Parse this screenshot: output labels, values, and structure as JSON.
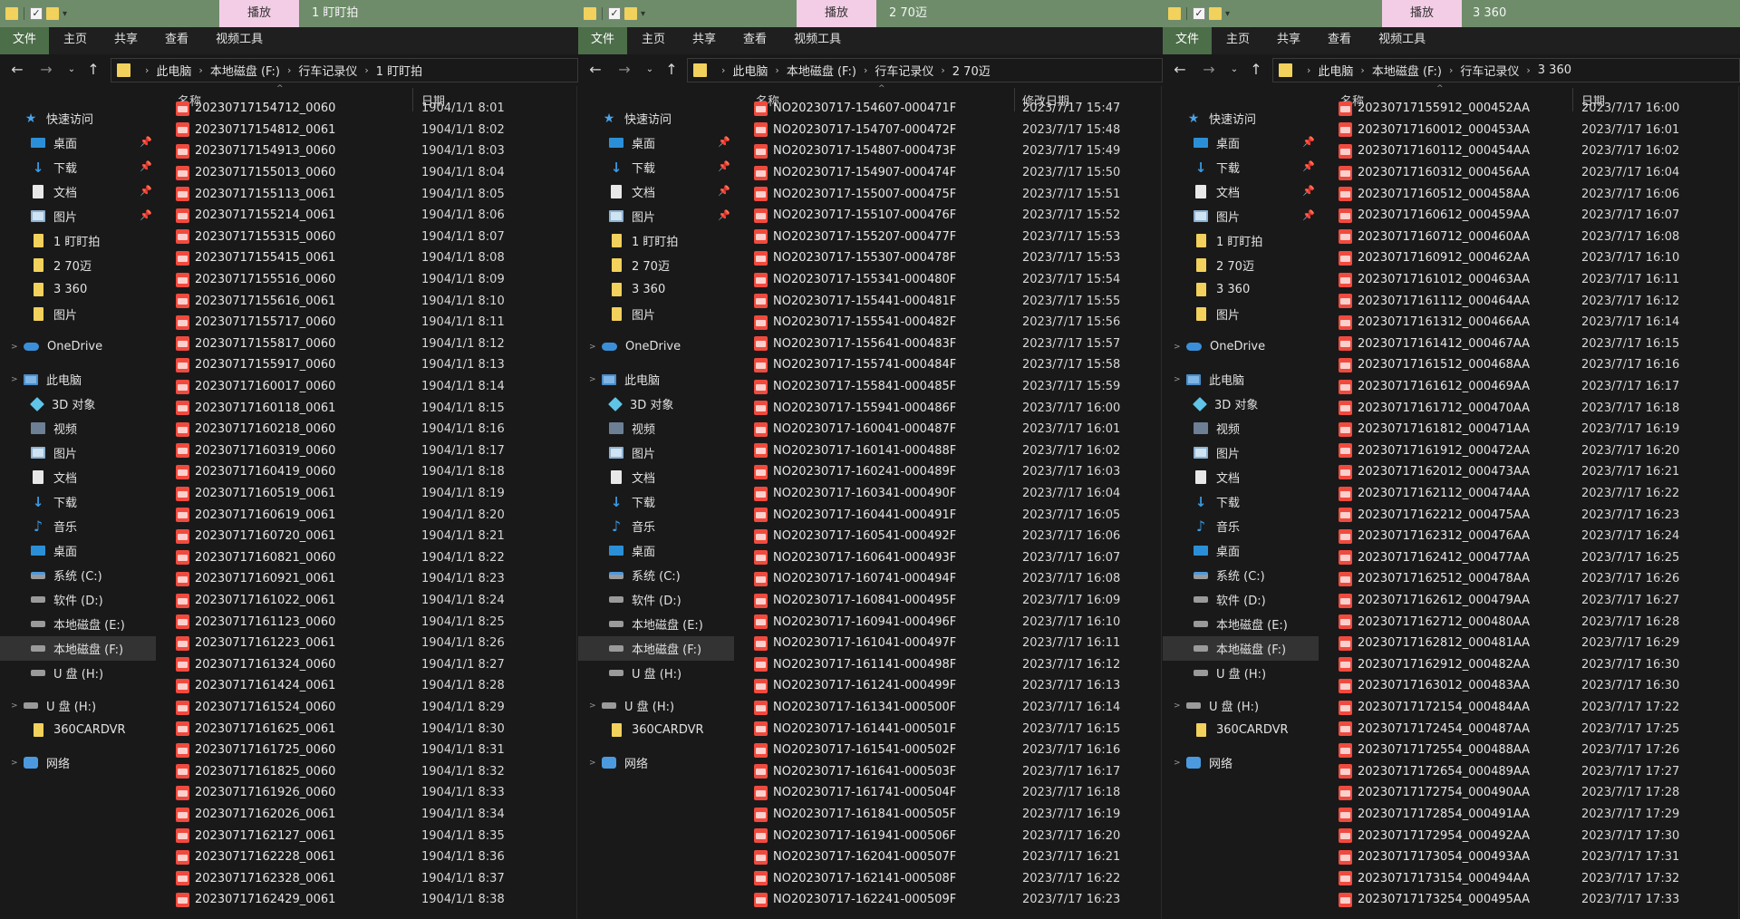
{
  "common": {
    "ribbon_tabs": [
      "文件",
      "主页",
      "共享",
      "查看",
      "视频工具"
    ],
    "context_tab": "播放",
    "column_name": "名称",
    "column_date_short": "日期",
    "column_date_modified": "修改日期",
    "breadcrumb_root": [
      "此电脑",
      "本地磁盘 (F:)",
      "行车记录仪"
    ],
    "quick_access_check": "✓",
    "nav_back_icon": "←",
    "nav_forward_icon": "→",
    "nav_recent_icon": "⌄",
    "nav_up_icon": "↑",
    "chevron": "›",
    "pin_icon": "📌",
    "sort_arrow": "^",
    "expand_icon": ">",
    "sidebar": [
      {
        "label": "快速访问",
        "icon": "star-icon",
        "level": 0,
        "pinned": false
      },
      {
        "label": "桌面",
        "icon": "desktop-icon",
        "level": 1,
        "pinned": true
      },
      {
        "label": "下载",
        "icon": "download-icon",
        "level": 1,
        "pinned": true
      },
      {
        "label": "文档",
        "icon": "document-icon",
        "level": 1,
        "pinned": true
      },
      {
        "label": "图片",
        "icon": "pictures-icon",
        "level": 1,
        "pinned": true
      },
      {
        "label": "1 盯盯拍",
        "icon": "folder-icon",
        "level": 1,
        "pinned": false
      },
      {
        "label": "2 70迈",
        "icon": "folder-icon",
        "level": 1,
        "pinned": false
      },
      {
        "label": "3 360",
        "icon": "folder-icon",
        "level": 1,
        "pinned": false
      },
      {
        "label": "图片",
        "icon": "folder-icon",
        "level": 1,
        "pinned": false
      },
      {
        "label": "OneDrive",
        "icon": "cloud-icon",
        "level": 0,
        "pinned": false,
        "gap": true
      },
      {
        "label": "此电脑",
        "icon": "computer-icon",
        "level": 0,
        "pinned": false,
        "gap": true
      },
      {
        "label": "3D 对象",
        "icon": "3d-objects-icon",
        "level": 1,
        "pinned": false
      },
      {
        "label": "视频",
        "icon": "video-icon",
        "level": 1,
        "pinned": false
      },
      {
        "label": "图片",
        "icon": "pictures-icon",
        "level": 1,
        "pinned": false
      },
      {
        "label": "文档",
        "icon": "document-icon",
        "level": 1,
        "pinned": false
      },
      {
        "label": "下载",
        "icon": "download-icon",
        "level": 1,
        "pinned": false
      },
      {
        "label": "音乐",
        "icon": "music-icon",
        "level": 1,
        "pinned": false
      },
      {
        "label": "桌面",
        "icon": "desktop-icon",
        "level": 1,
        "pinned": false
      },
      {
        "label": "系统 (C:)",
        "icon": "system-drive-icon",
        "level": 1,
        "pinned": false
      },
      {
        "label": "软件 (D:)",
        "icon": "drive-icon",
        "level": 1,
        "pinned": false
      },
      {
        "label": "本地磁盘 (E:)",
        "icon": "drive-icon",
        "level": 1,
        "pinned": false
      },
      {
        "label": "本地磁盘 (F:)",
        "icon": "drive-icon",
        "level": 1,
        "pinned": false,
        "selected": true
      },
      {
        "label": "U 盘 (H:)",
        "icon": "drive-icon",
        "level": 1,
        "pinned": false
      },
      {
        "label": "U 盘 (H:)",
        "icon": "drive-icon",
        "level": 0,
        "pinned": false,
        "gap": true
      },
      {
        "label": "360CARDVR",
        "icon": "folder-icon",
        "level": 1,
        "pinned": false
      },
      {
        "label": "网络",
        "icon": "network-icon",
        "level": 0,
        "pinned": false,
        "gap": true
      }
    ]
  },
  "windows": [
    {
      "title": "1 盯盯拍",
      "date_header_key": "column_date_short",
      "files": [
        [
          "20230717154712_0060",
          "1904/1/1 8:01"
        ],
        [
          "20230717154812_0061",
          "1904/1/1 8:02"
        ],
        [
          "20230717154913_0060",
          "1904/1/1 8:03"
        ],
        [
          "20230717155013_0060",
          "1904/1/1 8:04"
        ],
        [
          "20230717155113_0061",
          "1904/1/1 8:05"
        ],
        [
          "20230717155214_0061",
          "1904/1/1 8:06"
        ],
        [
          "20230717155315_0060",
          "1904/1/1 8:07"
        ],
        [
          "20230717155415_0061",
          "1904/1/1 8:08"
        ],
        [
          "20230717155516_0060",
          "1904/1/1 8:09"
        ],
        [
          "20230717155616_0061",
          "1904/1/1 8:10"
        ],
        [
          "20230717155717_0060",
          "1904/1/1 8:11"
        ],
        [
          "20230717155817_0060",
          "1904/1/1 8:12"
        ],
        [
          "20230717155917_0060",
          "1904/1/1 8:13"
        ],
        [
          "20230717160017_0060",
          "1904/1/1 8:14"
        ],
        [
          "20230717160118_0061",
          "1904/1/1 8:15"
        ],
        [
          "20230717160218_0060",
          "1904/1/1 8:16"
        ],
        [
          "20230717160319_0060",
          "1904/1/1 8:17"
        ],
        [
          "20230717160419_0060",
          "1904/1/1 8:18"
        ],
        [
          "20230717160519_0061",
          "1904/1/1 8:19"
        ],
        [
          "20230717160619_0061",
          "1904/1/1 8:20"
        ],
        [
          "20230717160720_0061",
          "1904/1/1 8:21"
        ],
        [
          "20230717160821_0060",
          "1904/1/1 8:22"
        ],
        [
          "20230717160921_0061",
          "1904/1/1 8:23"
        ],
        [
          "20230717161022_0061",
          "1904/1/1 8:24"
        ],
        [
          "20230717161123_0060",
          "1904/1/1 8:25"
        ],
        [
          "20230717161223_0061",
          "1904/1/1 8:26"
        ],
        [
          "20230717161324_0060",
          "1904/1/1 8:27"
        ],
        [
          "20230717161424_0061",
          "1904/1/1 8:28"
        ],
        [
          "20230717161524_0060",
          "1904/1/1 8:29"
        ],
        [
          "20230717161625_0061",
          "1904/1/1 8:30"
        ],
        [
          "20230717161725_0060",
          "1904/1/1 8:31"
        ],
        [
          "20230717161825_0060",
          "1904/1/1 8:32"
        ],
        [
          "20230717161926_0060",
          "1904/1/1 8:33"
        ],
        [
          "20230717162026_0061",
          "1904/1/1 8:34"
        ],
        [
          "20230717162127_0061",
          "1904/1/1 8:35"
        ],
        [
          "20230717162228_0061",
          "1904/1/1 8:36"
        ],
        [
          "20230717162328_0061",
          "1904/1/1 8:37"
        ],
        [
          "20230717162429_0061",
          "1904/1/1 8:38"
        ]
      ]
    },
    {
      "title": "2 70迈",
      "date_header_key": "column_date_modified",
      "files": [
        [
          "NO20230717-154607-000471F",
          "2023/7/17 15:47"
        ],
        [
          "NO20230717-154707-000472F",
          "2023/7/17 15:48"
        ],
        [
          "NO20230717-154807-000473F",
          "2023/7/17 15:49"
        ],
        [
          "NO20230717-154907-000474F",
          "2023/7/17 15:50"
        ],
        [
          "NO20230717-155007-000475F",
          "2023/7/17 15:51"
        ],
        [
          "NO20230717-155107-000476F",
          "2023/7/17 15:52"
        ],
        [
          "NO20230717-155207-000477F",
          "2023/7/17 15:53"
        ],
        [
          "NO20230717-155307-000478F",
          "2023/7/17 15:53"
        ],
        [
          "NO20230717-155341-000480F",
          "2023/7/17 15:54"
        ],
        [
          "NO20230717-155441-000481F",
          "2023/7/17 15:55"
        ],
        [
          "NO20230717-155541-000482F",
          "2023/7/17 15:56"
        ],
        [
          "NO20230717-155641-000483F",
          "2023/7/17 15:57"
        ],
        [
          "NO20230717-155741-000484F",
          "2023/7/17 15:58"
        ],
        [
          "NO20230717-155841-000485F",
          "2023/7/17 15:59"
        ],
        [
          "NO20230717-155941-000486F",
          "2023/7/17 16:00"
        ],
        [
          "NO20230717-160041-000487F",
          "2023/7/17 16:01"
        ],
        [
          "NO20230717-160141-000488F",
          "2023/7/17 16:02"
        ],
        [
          "NO20230717-160241-000489F",
          "2023/7/17 16:03"
        ],
        [
          "NO20230717-160341-000490F",
          "2023/7/17 16:04"
        ],
        [
          "NO20230717-160441-000491F",
          "2023/7/17 16:05"
        ],
        [
          "NO20230717-160541-000492F",
          "2023/7/17 16:06"
        ],
        [
          "NO20230717-160641-000493F",
          "2023/7/17 16:07"
        ],
        [
          "NO20230717-160741-000494F",
          "2023/7/17 16:08"
        ],
        [
          "NO20230717-160841-000495F",
          "2023/7/17 16:09"
        ],
        [
          "NO20230717-160941-000496F",
          "2023/7/17 16:10"
        ],
        [
          "NO20230717-161041-000497F",
          "2023/7/17 16:11"
        ],
        [
          "NO20230717-161141-000498F",
          "2023/7/17 16:12"
        ],
        [
          "NO20230717-161241-000499F",
          "2023/7/17 16:13"
        ],
        [
          "NO20230717-161341-000500F",
          "2023/7/17 16:14"
        ],
        [
          "NO20230717-161441-000501F",
          "2023/7/17 16:15"
        ],
        [
          "NO20230717-161541-000502F",
          "2023/7/17 16:16"
        ],
        [
          "NO20230717-161641-000503F",
          "2023/7/17 16:17"
        ],
        [
          "NO20230717-161741-000504F",
          "2023/7/17 16:18"
        ],
        [
          "NO20230717-161841-000505F",
          "2023/7/17 16:19"
        ],
        [
          "NO20230717-161941-000506F",
          "2023/7/17 16:20"
        ],
        [
          "NO20230717-162041-000507F",
          "2023/7/17 16:21"
        ],
        [
          "NO20230717-162141-000508F",
          "2023/7/17 16:22"
        ],
        [
          "NO20230717-162241-000509F",
          "2023/7/17 16:23"
        ]
      ]
    },
    {
      "title": "3 360",
      "date_header_key": "column_date_short",
      "files": [
        [
          "20230717155912_000452AA",
          "2023/7/17 16:00"
        ],
        [
          "20230717160012_000453AA",
          "2023/7/17 16:01"
        ],
        [
          "20230717160112_000454AA",
          "2023/7/17 16:02"
        ],
        [
          "20230717160312_000456AA",
          "2023/7/17 16:04"
        ],
        [
          "20230717160512_000458AA",
          "2023/7/17 16:06"
        ],
        [
          "20230717160612_000459AA",
          "2023/7/17 16:07"
        ],
        [
          "20230717160712_000460AA",
          "2023/7/17 16:08"
        ],
        [
          "20230717160912_000462AA",
          "2023/7/17 16:10"
        ],
        [
          "20230717161012_000463AA",
          "2023/7/17 16:11"
        ],
        [
          "20230717161112_000464AA",
          "2023/7/17 16:12"
        ],
        [
          "20230717161312_000466AA",
          "2023/7/17 16:14"
        ],
        [
          "20230717161412_000467AA",
          "2023/7/17 16:15"
        ],
        [
          "20230717161512_000468AA",
          "2023/7/17 16:16"
        ],
        [
          "20230717161612_000469AA",
          "2023/7/17 16:17"
        ],
        [
          "20230717161712_000470AA",
          "2023/7/17 16:18"
        ],
        [
          "20230717161812_000471AA",
          "2023/7/17 16:19"
        ],
        [
          "20230717161912_000472AA",
          "2023/7/17 16:20"
        ],
        [
          "20230717162012_000473AA",
          "2023/7/17 16:21"
        ],
        [
          "20230717162112_000474AA",
          "2023/7/17 16:22"
        ],
        [
          "20230717162212_000475AA",
          "2023/7/17 16:23"
        ],
        [
          "20230717162312_000476AA",
          "2023/7/17 16:24"
        ],
        [
          "20230717162412_000477AA",
          "2023/7/17 16:25"
        ],
        [
          "20230717162512_000478AA",
          "2023/7/17 16:26"
        ],
        [
          "20230717162612_000479AA",
          "2023/7/17 16:27"
        ],
        [
          "20230717162712_000480AA",
          "2023/7/17 16:28"
        ],
        [
          "20230717162812_000481AA",
          "2023/7/17 16:29"
        ],
        [
          "20230717162912_000482AA",
          "2023/7/17 16:30"
        ],
        [
          "20230717163012_000483AA",
          "2023/7/17 16:30"
        ],
        [
          "20230717172154_000484AA",
          "2023/7/17 17:22"
        ],
        [
          "20230717172454_000487AA",
          "2023/7/17 17:25"
        ],
        [
          "20230717172554_000488AA",
          "2023/7/17 17:26"
        ],
        [
          "20230717172654_000489AA",
          "2023/7/17 17:27"
        ],
        [
          "20230717172754_000490AA",
          "2023/7/17 17:28"
        ],
        [
          "20230717172854_000491AA",
          "2023/7/17 17:29"
        ],
        [
          "20230717172954_000492AA",
          "2023/7/17 17:30"
        ],
        [
          "20230717173054_000493AA",
          "2023/7/17 17:31"
        ],
        [
          "20230717173154_000494AA",
          "2023/7/17 17:32"
        ],
        [
          "20230717173254_000495AA",
          "2023/7/17 17:33"
        ]
      ]
    }
  ]
}
